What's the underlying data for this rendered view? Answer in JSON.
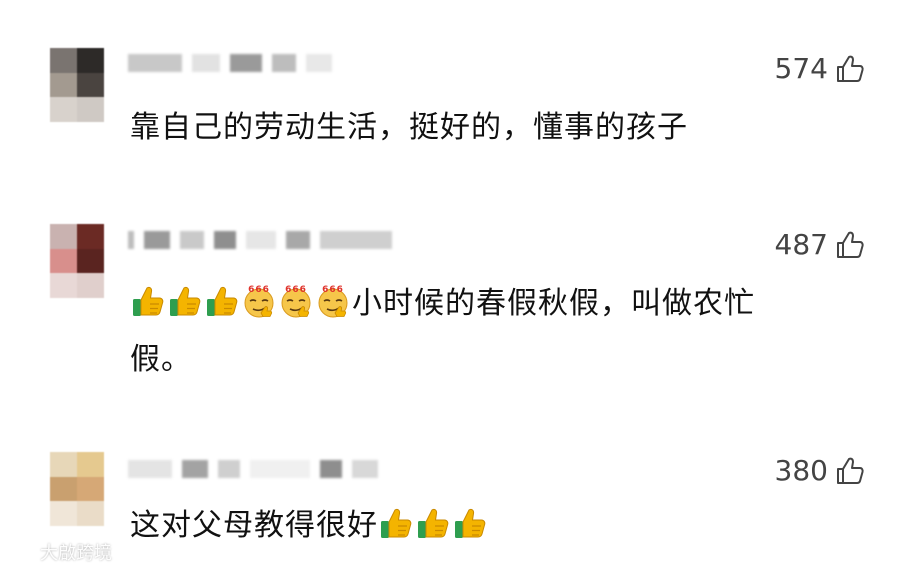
{
  "comments": [
    {
      "likes": "574",
      "text": "靠自己的劳动生活，挺好的，懂事的孩子",
      "avatar_colors": [
        "#7a7470",
        "#2d2a28",
        "#a39a90",
        "#4a4440",
        "#d8d2cc",
        "#cfc9c4"
      ]
    },
    {
      "likes": "487",
      "text_line1": "小时候的春假秋假，叫做农忙",
      "text_line2": "假。",
      "avatar_colors": [
        "#c9b2b0",
        "#6b2a24",
        "#d88f8c",
        "#5a2420",
        "#e8d8d6",
        "#e0cfcc"
      ]
    },
    {
      "likes": "380",
      "text": "这对父母教得很好",
      "avatar_colors": [
        "#e7d7b8",
        "#e5c98f",
        "#c9a06f",
        "#d6a876",
        "#f0e6d8",
        "#eadcc8"
      ]
    }
  ],
  "watermark": {
    "text": "大啟跨境"
  },
  "colors": {
    "text": "#111111",
    "likes": "#444444",
    "thumb_emoji": "#f4b400",
    "thumb_cuff": "#2e9e4f"
  },
  "icons": {
    "like": "thumbs-up-outline-icon",
    "thumb_emoji": "thumbs-up-emoji",
    "emoji_666": "666-smirk-emoji"
  }
}
